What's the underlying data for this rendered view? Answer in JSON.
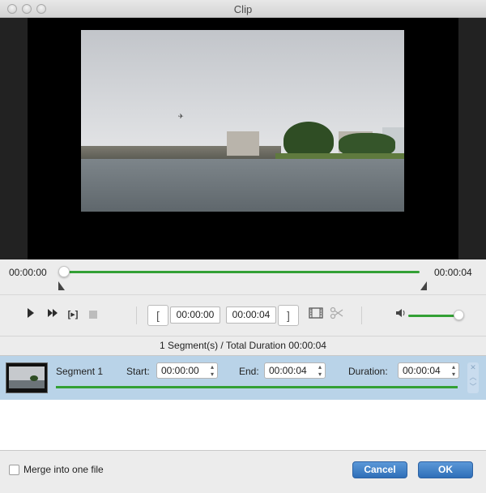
{
  "window": {
    "title": "Clip"
  },
  "timeline": {
    "start_time": "00:00:00",
    "end_time": "00:00:04",
    "progress_fraction": 0.0
  },
  "controls": {
    "play_icon": "play-icon",
    "fast_forward_icon": "fast-forward-icon",
    "step_icon": "frame-step-icon",
    "step_glyph": "[▸]",
    "stop_icon": "stop-icon",
    "set_start_glyph": "[",
    "set_end_glyph": "]",
    "start_time": "00:00:00",
    "end_time": "00:00:04",
    "add_segment_icon": "film-clip-icon",
    "cut_icon": "scissors-icon",
    "volume_icon": "speaker-icon",
    "volume_fraction": 1.0
  },
  "summary": {
    "text": "1 Segment(s) / Total Duration 00:00:04"
  },
  "segments": [
    {
      "name": "Segment 1",
      "start_label": "Start:",
      "start": "00:00:00",
      "end_label": "End:",
      "end": "00:00:04",
      "duration_label": "Duration:",
      "duration": "00:00:04"
    }
  ],
  "footer": {
    "merge_label": "Merge into one file",
    "merge_checked": false,
    "cancel_label": "Cancel",
    "ok_label": "OK"
  },
  "colors": {
    "accent_green": "#33a035",
    "selection_blue": "#b9d3e8",
    "button_blue": "#2f6fb8"
  }
}
